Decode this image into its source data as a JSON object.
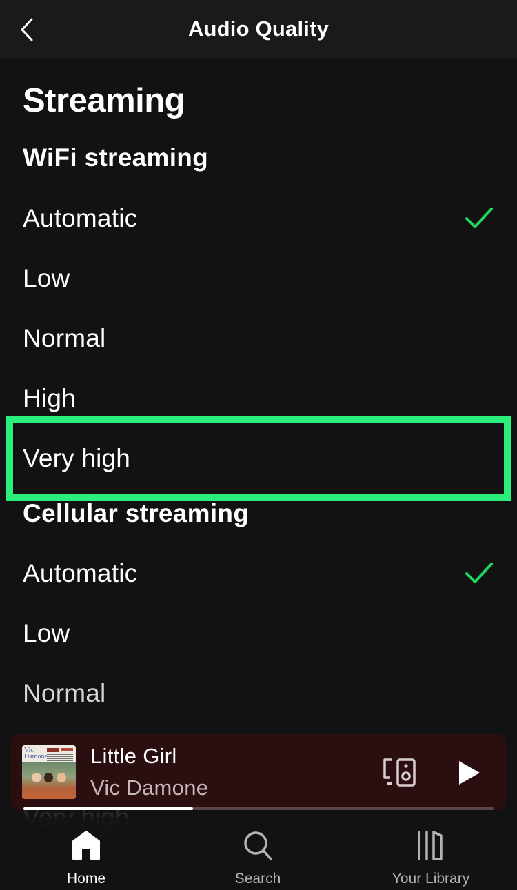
{
  "header": {
    "title": "Audio Quality",
    "back_icon": "chevron-left-icon"
  },
  "section": {
    "title": "Streaming"
  },
  "wifi": {
    "title": "WiFi streaming",
    "selected": "Automatic",
    "options": [
      {
        "label": "Automatic",
        "checked": true
      },
      {
        "label": "Low",
        "checked": false
      },
      {
        "label": "Normal",
        "checked": false
      },
      {
        "label": "High",
        "checked": false
      },
      {
        "label": "Very high",
        "checked": false,
        "highlighted": true
      }
    ]
  },
  "cellular": {
    "title": "Cellular streaming",
    "selected": "Automatic",
    "options": [
      {
        "label": "Automatic",
        "checked": true
      },
      {
        "label": "Low",
        "checked": false
      },
      {
        "label": "Normal",
        "checked": false
      },
      {
        "label": "Very high",
        "checked": false
      }
    ]
  },
  "mini_player": {
    "track_title": "Little Girl",
    "artist": "Vic Damone",
    "album_art_text": "Vic Damone",
    "progress_fraction": 0.36,
    "devices_icon": "devices-speaker-icon",
    "play_icon": "play-icon"
  },
  "bottom_nav": {
    "items": [
      {
        "label": "Home",
        "icon": "home-icon",
        "active": true
      },
      {
        "label": "Search",
        "icon": "search-icon",
        "active": false
      },
      {
        "label": "Your Library",
        "icon": "library-icon",
        "active": false
      }
    ]
  },
  "colors": {
    "background": "#121212",
    "header_bg": "#1a1a1a",
    "accent_green": "#1ed760",
    "highlight_border": "#2bef7c",
    "mini_player_bg": "#2b0e10",
    "artist_text": "#c7b7b8",
    "inactive_nav": "#b3b3b3"
  }
}
